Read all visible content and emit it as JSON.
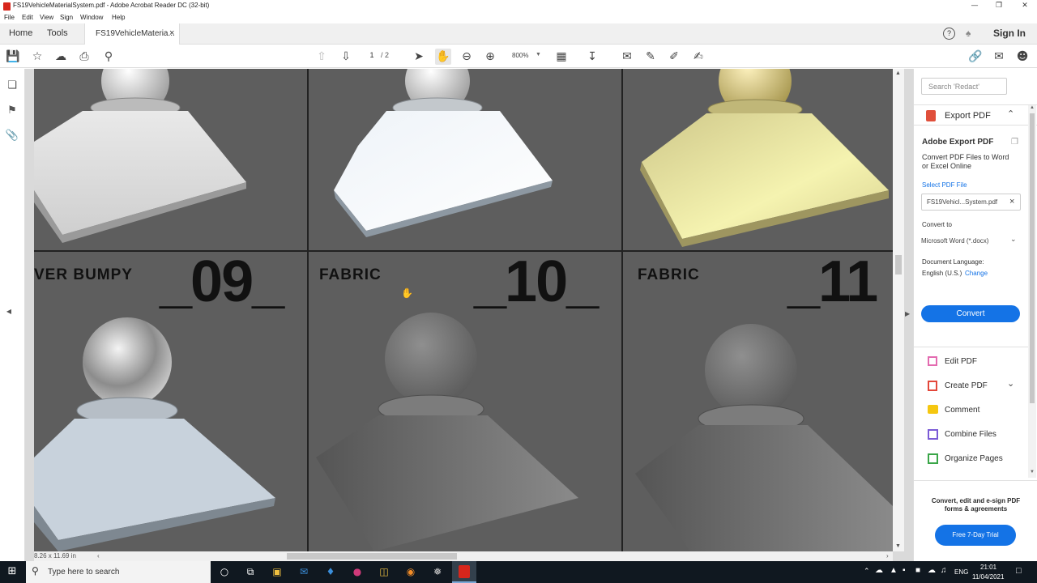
{
  "window": {
    "title": "FS19VehicleMaterialSystem.pdf - Adobe Acrobat Reader DC (32-bit)",
    "minimize": "—",
    "restore": "❐",
    "close": "✕"
  },
  "menu": [
    "File",
    "Edit",
    "View",
    "Sign",
    "Window",
    "Help"
  ],
  "tabs": {
    "home": "Home",
    "tools": "Tools",
    "document": "FS19VehicleMateria...",
    "close_glyph": "×",
    "help_glyph": "?",
    "sign_in": "Sign In"
  },
  "toolbar": {
    "page_current": "1",
    "page_total": "/ 2",
    "zoom": "800%"
  },
  "document": {
    "labels": {
      "left": "VER BUMPY",
      "middle": "FABRIC",
      "right": "FABRIC"
    },
    "numbers": {
      "left": "_09_",
      "middle": "_10_",
      "right": "_11"
    },
    "page_size": "8.26 x 11.69 in"
  },
  "right_panel": {
    "search_placeholder": "Search 'Redact'",
    "export_title": "Export PDF",
    "adobe_export": "Adobe Export PDF",
    "export_desc1": "Convert PDF Files to Word",
    "export_desc2": "or Excel Online",
    "select_file": "Select PDF File",
    "file_name": "FS19Vehicl...System.pdf",
    "convert_to": "Convert to",
    "format": "Microsoft Word (*.docx)",
    "doc_language": "Document Language:",
    "language": "English (U.S.)",
    "change": "Change",
    "convert_button": "Convert",
    "tools": [
      "Edit PDF",
      "Create PDF",
      "Comment",
      "Combine Files",
      "Organize Pages"
    ],
    "promo1": "Convert, edit and e-sign PDF",
    "promo2": "forms & agreements",
    "trial_button": "Free 7-Day Trial"
  },
  "taskbar": {
    "search": "Type here to search",
    "lang": "ENG",
    "time": "21:01",
    "date": "11/04/2021"
  },
  "colors": {
    "accent": "#1473e6",
    "pdf_red": "#d7261c",
    "page_bg": "#5b5b5b"
  }
}
